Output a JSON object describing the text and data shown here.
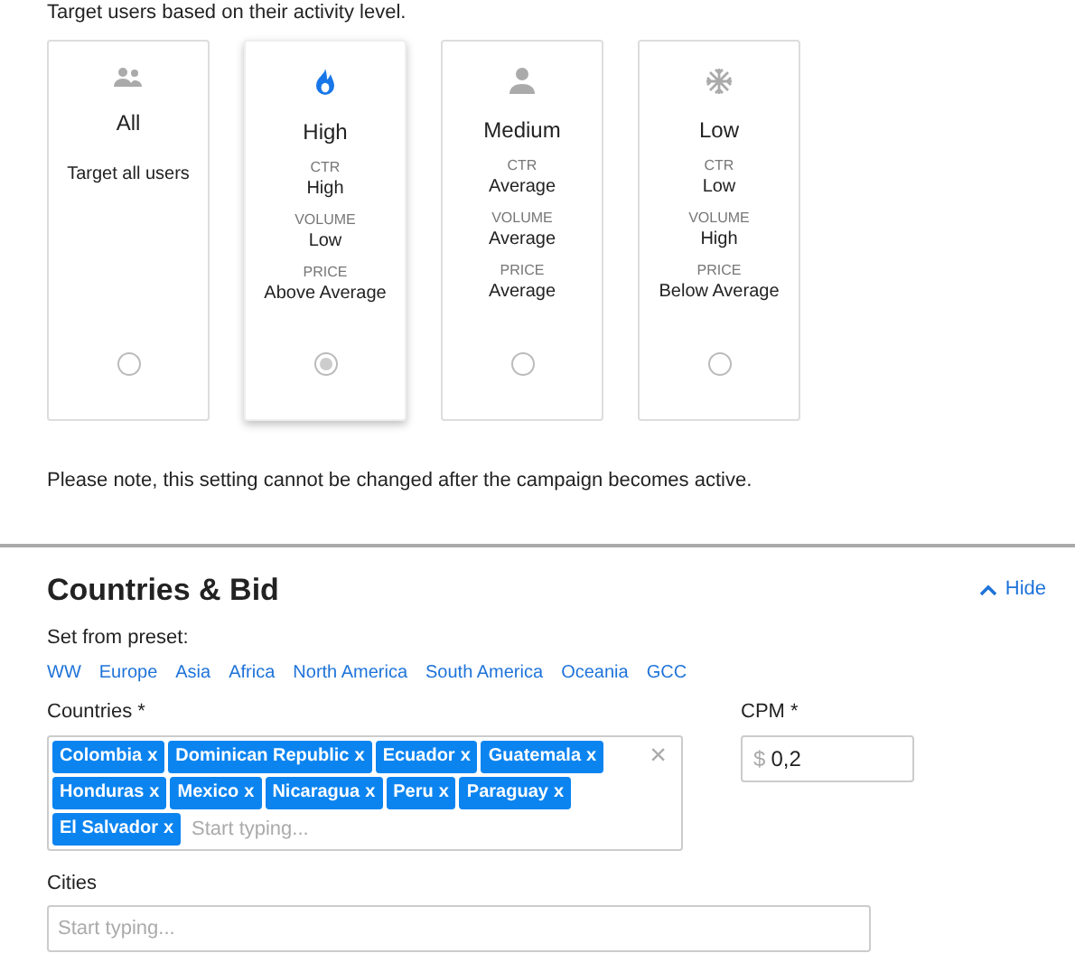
{
  "intro": "Target users based on their activity level.",
  "options": [
    {
      "kind": "people",
      "title": "All",
      "description": "Target all users",
      "selected": false
    },
    {
      "kind": "flame",
      "title": "High",
      "stats": [
        {
          "label": "CTR",
          "value": "High"
        },
        {
          "label": "VOLUME",
          "value": "Low"
        },
        {
          "label": "PRICE",
          "value": "Above Average"
        }
      ],
      "selected": true
    },
    {
      "kind": "person",
      "title": "Medium",
      "stats": [
        {
          "label": "CTR",
          "value": "Average"
        },
        {
          "label": "VOLUME",
          "value": "Average"
        },
        {
          "label": "PRICE",
          "value": "Average"
        }
      ],
      "selected": false
    },
    {
      "kind": "snowflake",
      "title": "Low",
      "stats": [
        {
          "label": "CTR",
          "value": "Low"
        },
        {
          "label": "VOLUME",
          "value": "High"
        },
        {
          "label": "PRICE",
          "value": "Below Average"
        }
      ],
      "selected": false
    }
  ],
  "note": "Please note, this setting cannot be changed after the campaign becomes active.",
  "section": {
    "title": "Countries & Bid",
    "toggle": "Hide",
    "expanded": true
  },
  "preset_label": "Set from preset:",
  "presets": [
    "WW",
    "Europe",
    "Asia",
    "Africa",
    "North America",
    "South America",
    "Oceania",
    "GCC"
  ],
  "countries": {
    "label": "Countries *",
    "clear": "×",
    "placeholder": "Start typing...",
    "tags": [
      {
        "label": "Colombia",
        "remove": "x"
      },
      {
        "label": "Dominican Republic",
        "remove": "x"
      },
      {
        "label": "Ecuador",
        "remove": "x"
      },
      {
        "label": "Guatemala",
        "remove": "x"
      },
      {
        "label": "Honduras",
        "remove": "x"
      },
      {
        "label": "Mexico",
        "remove": "x"
      },
      {
        "label": "Nicaragua",
        "remove": "x"
      },
      {
        "label": "Peru",
        "remove": "x"
      },
      {
        "label": "Paraguay",
        "remove": "x"
      },
      {
        "label": "El Salvador",
        "remove": "x"
      }
    ]
  },
  "cpm": {
    "label": "CPM *",
    "prefix": "$",
    "value": "0,2"
  },
  "cities": {
    "label": "Cities",
    "placeholder": "Start typing..."
  }
}
